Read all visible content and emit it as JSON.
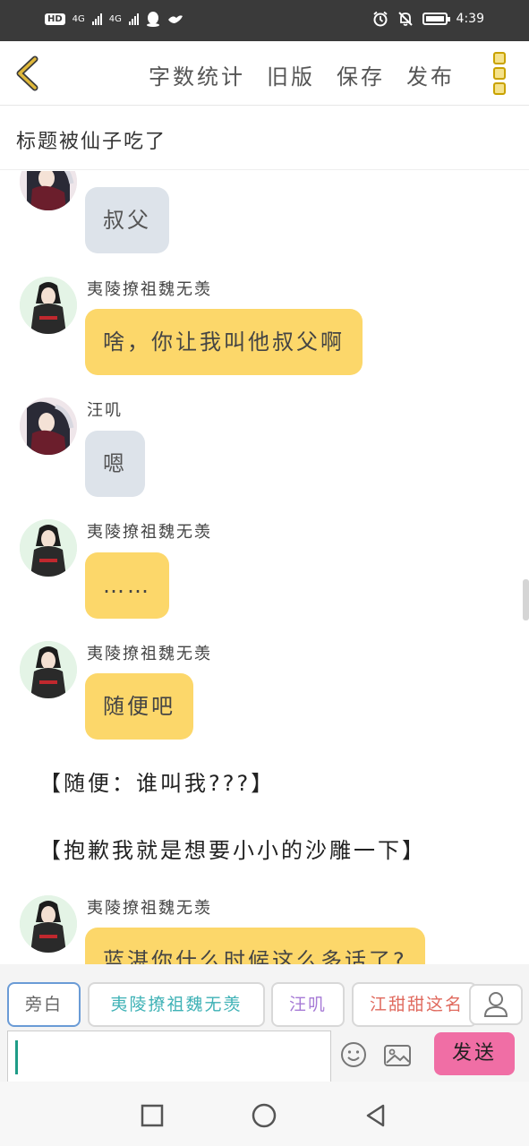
{
  "status_bar": {
    "hd": "HD",
    "sim1": "4G",
    "sim2": "4G",
    "time": "4:39"
  },
  "toolbar": {
    "word_count": "字数统计",
    "old_version": "旧版",
    "save": "保存",
    "publish": "发布"
  },
  "title": "标题被仙子吃了",
  "messages": [
    {
      "speaker": "",
      "text": "叔父",
      "style": "gray"
    },
    {
      "speaker": "夷陵撩祖魏无羡",
      "text": "啥，你让我叫他叔父啊",
      "style": "yellow"
    },
    {
      "speaker": "汪叽",
      "text": "嗯",
      "style": "gray"
    },
    {
      "speaker": "夷陵撩祖魏无羡",
      "text": "……",
      "style": "yellow"
    },
    {
      "speaker": "夷陵撩祖魏无羡",
      "text": "随便吧",
      "style": "yellow"
    }
  ],
  "asides": [
    "【随便：谁叫我???】",
    "【抱歉我就是想要小小的沙雕一下】"
  ],
  "last_message": {
    "speaker": "夷陵撩祖魏无羡",
    "text": "蓝湛你什么时候这么多话了?"
  },
  "roles": {
    "narration": "旁白",
    "wei": "夷陵撩祖魏无羡",
    "wang": "汪叽",
    "jiang": "江甜甜这名"
  },
  "input": {
    "value": ""
  },
  "send_label": "发送",
  "colors": {
    "status_bar": "#3a3a3a",
    "bubble_gray": "#dde3ea",
    "bubble_yellow": "#fcd76a",
    "send_button": "#f06ea5",
    "role_wei": "#3fb2b6",
    "role_wang": "#a77bd6",
    "role_jiang": "#e06a5e",
    "back_arrow": "#e0b83a"
  },
  "icons": {
    "back": "chevron-left-icon",
    "menu": "more-vertical-icon",
    "user": "user-icon",
    "emoji": "smiley-icon",
    "image": "image-icon",
    "nav_square": "recent-apps-icon",
    "nav_circle": "home-icon",
    "nav_back": "back-triangle-icon"
  }
}
